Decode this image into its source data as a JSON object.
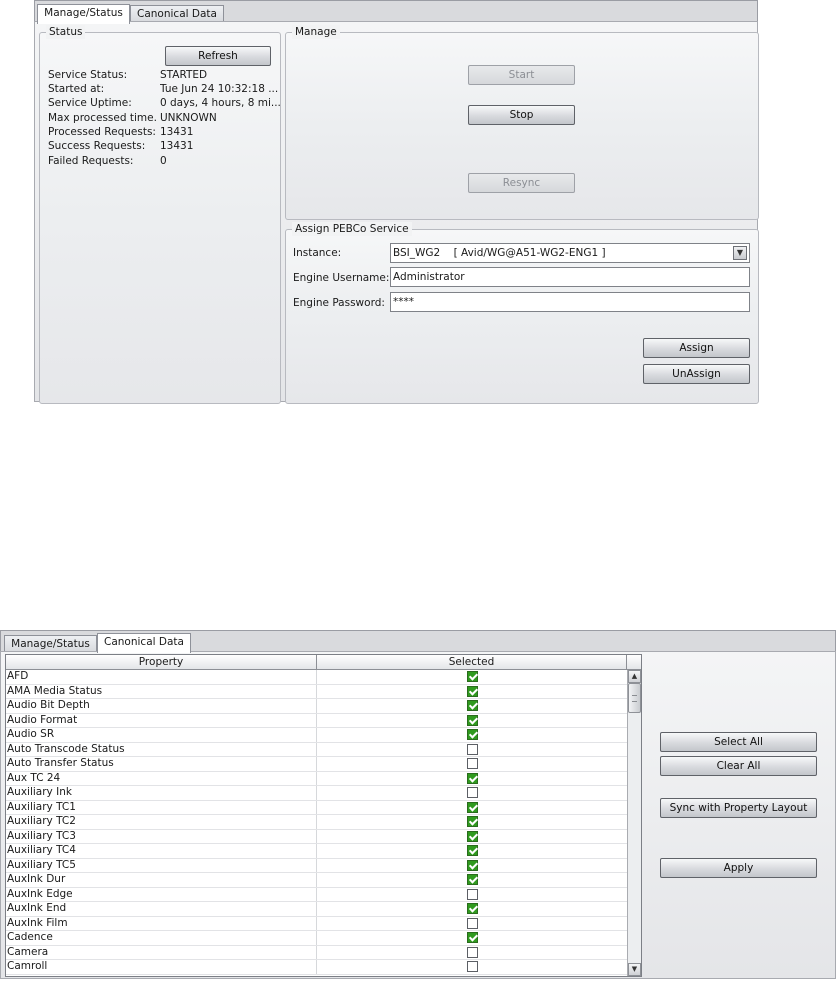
{
  "top_panel": {
    "tabs": [
      {
        "label": "Manage/Status",
        "active": true
      },
      {
        "label": "Canonical Data",
        "active": false
      }
    ],
    "status": {
      "title": "Status",
      "refresh_label": "Refresh",
      "rows": [
        {
          "label": "Service Status:",
          "value": "STARTED"
        },
        {
          "label": "Started at:",
          "value": "Tue Jun 24 10:32:18 ..."
        },
        {
          "label": "Service Uptime:",
          "value": "0 days, 4 hours, 8 mi..."
        },
        {
          "label": "Max processed time...",
          "value": "UNKNOWN"
        },
        {
          "label": "Processed Requests:",
          "value": "13431"
        },
        {
          "label": "Success Requests:",
          "value": "13431"
        },
        {
          "label": "Failed Requests:",
          "value": "0"
        }
      ]
    },
    "manage": {
      "title": "Manage",
      "start_label": "Start",
      "stop_label": "Stop",
      "resync_label": "Resync"
    },
    "assign": {
      "title": "Assign PEBCo Service",
      "instance_label": "Instance:",
      "instance_value": "BSI_WG2    [ Avid/WG@A51-WG2-ENG1 ]",
      "username_label": "Engine Username:",
      "username_value": "Administrator",
      "password_label": "Engine Password:",
      "password_value": "****",
      "assign_label": "Assign",
      "unassign_label": "UnAssign"
    }
  },
  "bottom_panel": {
    "tabs": [
      {
        "label": "Manage/Status",
        "active": false
      },
      {
        "label": "Canonical Data",
        "active": true
      }
    ],
    "table": {
      "columns": [
        "Property",
        "Selected"
      ],
      "rows": [
        {
          "property": "AFD",
          "selected": true
        },
        {
          "property": "AMA Media Status",
          "selected": true
        },
        {
          "property": "Audio Bit Depth",
          "selected": true
        },
        {
          "property": "Audio Format",
          "selected": true
        },
        {
          "property": "Audio SR",
          "selected": true
        },
        {
          "property": "Auto Transcode Status",
          "selected": false
        },
        {
          "property": "Auto Transfer Status",
          "selected": false
        },
        {
          "property": "Aux TC 24",
          "selected": true
        },
        {
          "property": "Auxiliary Ink",
          "selected": false
        },
        {
          "property": "Auxiliary TC1",
          "selected": true
        },
        {
          "property": "Auxiliary TC2",
          "selected": true
        },
        {
          "property": "Auxiliary TC3",
          "selected": true
        },
        {
          "property": "Auxiliary TC4",
          "selected": true
        },
        {
          "property": "Auxiliary TC5",
          "selected": true
        },
        {
          "property": "AuxInk Dur",
          "selected": true
        },
        {
          "property": "AuxInk Edge",
          "selected": false
        },
        {
          "property": "AuxInk End",
          "selected": true
        },
        {
          "property": "AuxInk Film",
          "selected": false
        },
        {
          "property": "Cadence",
          "selected": true
        },
        {
          "property": "Camera",
          "selected": false
        },
        {
          "property": "Camroll",
          "selected": false
        }
      ]
    },
    "buttons": {
      "select_all_label": "Select All",
      "clear_all_label": "Clear All",
      "sync_label": "Sync with Property Layout",
      "apply_label": "Apply"
    }
  }
}
